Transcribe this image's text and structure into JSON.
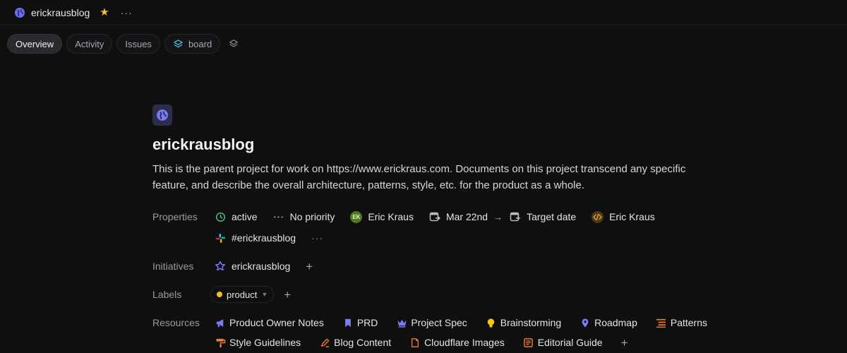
{
  "topbar": {
    "title": "erickrausblog",
    "more": "···"
  },
  "tabs": [
    {
      "label": "Overview"
    },
    {
      "label": "Activity"
    },
    {
      "label": "Issues"
    },
    {
      "label": "board"
    }
  ],
  "project": {
    "title": "erickrausblog",
    "description": "This is the parent project for work on https://www.erickraus.com. Documents on this project transcend any specific feature, and describe the overall architecture, patterns, style, etc. for the product as a whole."
  },
  "properties": {
    "label": "Properties",
    "status": "active",
    "priority": "No priority",
    "lead_initials": "EK",
    "lead": "Eric Kraus",
    "start_date": "Mar 22nd",
    "arrow": "→",
    "target_date": "Target date",
    "member": "Eric Kraus",
    "slack_channel": "#erickrausblog",
    "more": "···"
  },
  "initiatives": {
    "label": "Initiatives",
    "item": "erickrausblog"
  },
  "labels": {
    "label": "Labels",
    "item": "product"
  },
  "resources": {
    "label": "Resources",
    "items": [
      {
        "label": "Product Owner Notes",
        "icon": "megaphone-icon"
      },
      {
        "label": "PRD",
        "icon": "bookmark-icon"
      },
      {
        "label": "Project Spec",
        "icon": "crown-icon"
      },
      {
        "label": "Brainstorming",
        "icon": "lightbulb-icon"
      },
      {
        "label": "Roadmap",
        "icon": "map-pin-icon"
      },
      {
        "label": "Patterns",
        "icon": "list-icon"
      },
      {
        "label": "Style Guidelines",
        "icon": "brush-icon"
      },
      {
        "label": "Blog Content",
        "icon": "pen-icon"
      },
      {
        "label": "Cloudflare Images",
        "icon": "document-icon"
      },
      {
        "label": "Editorial Guide",
        "icon": "notes-icon"
      }
    ]
  },
  "colors": {
    "background": "#0f0f10",
    "accent_indigo": "#6c6ff5",
    "status_green": "#4cb782",
    "star_yellow": "#f5c518"
  }
}
